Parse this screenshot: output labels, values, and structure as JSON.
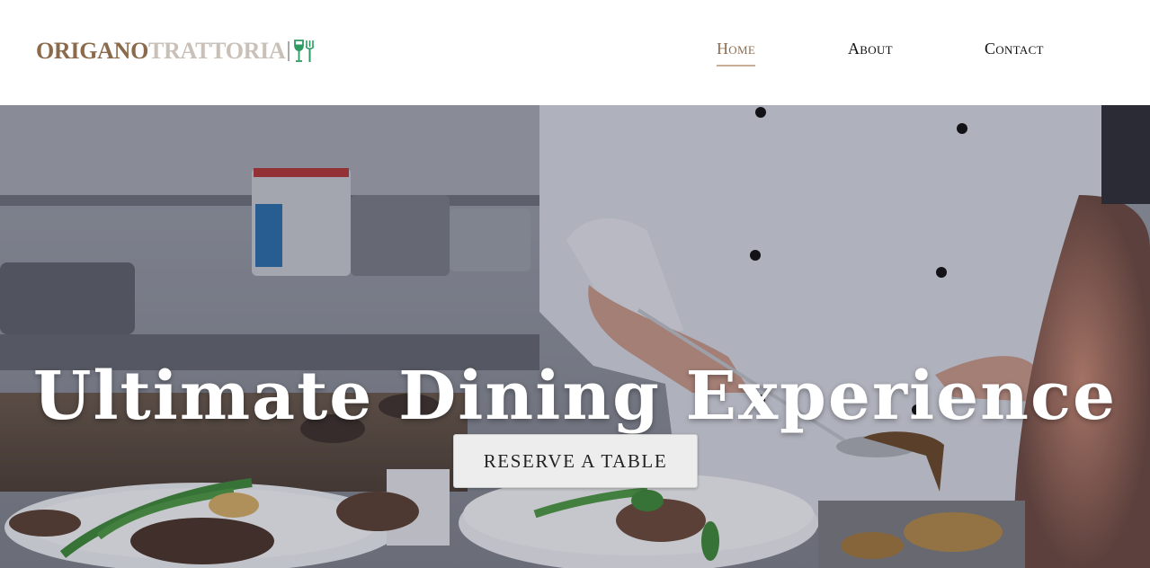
{
  "brand": {
    "name_part1": "ORIGANO",
    "name_part2": "TRATTORIA",
    "icon": "wine-glass-and-fork-icon",
    "color_part1": "#8a6a4a",
    "color_part2": "#c9c0b8",
    "icon_color": "#2e9a63"
  },
  "nav": {
    "items": [
      {
        "label": "Home",
        "active": true
      },
      {
        "label": "About",
        "active": false
      },
      {
        "label": "Contact",
        "active": false
      }
    ],
    "active_color": "#8f6c4c"
  },
  "hero": {
    "title": "Ultimate Dining Experience",
    "cta_label": "RESERVE A TABLE"
  }
}
